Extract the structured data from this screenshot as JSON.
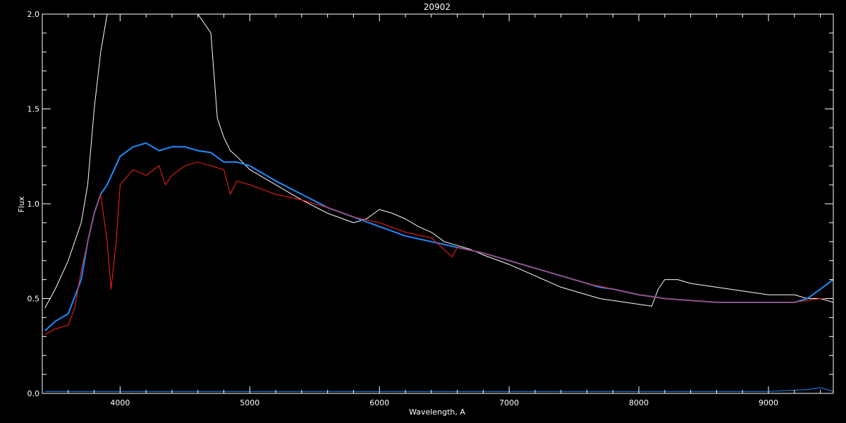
{
  "chart_data": {
    "type": "line",
    "title": "20902",
    "xlabel": "Wavelength, A",
    "ylabel": "Flux",
    "xlim": [
      3400,
      9500
    ],
    "ylim": [
      0.0,
      2.0
    ],
    "x_ticks": [
      4000,
      5000,
      6000,
      7000,
      8000,
      9000
    ],
    "x_tick_labels": [
      "4000",
      "5000",
      "6000",
      "7000",
      "8000",
      "9000"
    ],
    "y_ticks": [
      0.0,
      0.5,
      1.0,
      1.5,
      2.0
    ],
    "y_tick_labels": [
      "0.0",
      "0.5",
      "1.0",
      "1.5",
      "2.0"
    ],
    "background": "#000000",
    "axes_color": "#ffffff",
    "grid": false,
    "legend": "none",
    "series": [
      {
        "color": "#ffffff",
        "x": [
          3420,
          3500,
          3600,
          3700,
          3750,
          3800,
          3850,
          3900,
          4000,
          4100,
          4200,
          4300,
          4400,
          4500,
          4600,
          4700,
          4750,
          4800,
          4850,
          4900,
          5000,
          5200,
          5400,
          5600,
          5800,
          5900,
          6000,
          6100,
          6200,
          6300,
          6400,
          6500,
          6600,
          6700,
          6800,
          7000,
          7200,
          7400,
          7600,
          7700,
          7800,
          7900,
          8000,
          8100,
          8150,
          8200,
          8300,
          8400,
          8600,
          8800,
          9000,
          9200,
          9300,
          9400,
          9500
        ],
        "y": [
          0.45,
          0.55,
          0.7,
          0.9,
          1.1,
          1.5,
          1.8,
          2.0,
          2.0,
          2.0,
          2.0,
          2.0,
          2.0,
          2.0,
          2.0,
          1.9,
          1.45,
          1.35,
          1.28,
          1.25,
          1.18,
          1.1,
          1.02,
          0.95,
          0.9,
          0.92,
          0.97,
          0.95,
          0.92,
          0.88,
          0.85,
          0.8,
          0.78,
          0.76,
          0.73,
          0.68,
          0.62,
          0.56,
          0.52,
          0.5,
          0.49,
          0.48,
          0.47,
          0.46,
          0.55,
          0.6,
          0.6,
          0.58,
          0.56,
          0.54,
          0.52,
          0.52,
          0.5,
          0.5,
          0.48
        ]
      },
      {
        "color": "#1e8cff",
        "x": [
          3420,
          3500,
          3600,
          3700,
          3750,
          3800,
          3850,
          3900,
          4000,
          4100,
          4200,
          4300,
          4400,
          4500,
          4600,
          4700,
          4800,
          4900,
          5000,
          5200,
          5400,
          5600,
          5800,
          6000,
          6200,
          6400,
          6600,
          6800,
          7000,
          7200,
          7400,
          7600,
          7700,
          7800,
          8000,
          8100,
          8200,
          8400,
          8600,
          8800,
          9000,
          9200,
          9300,
          9400,
          9500
        ],
        "y": [
          0.33,
          0.38,
          0.42,
          0.6,
          0.8,
          0.95,
          1.05,
          1.1,
          1.25,
          1.3,
          1.32,
          1.28,
          1.3,
          1.3,
          1.28,
          1.27,
          1.22,
          1.22,
          1.2,
          1.12,
          1.05,
          0.98,
          0.93,
          0.88,
          0.83,
          0.8,
          0.77,
          0.74,
          0.7,
          0.66,
          0.62,
          0.58,
          0.56,
          0.55,
          0.52,
          0.51,
          0.5,
          0.49,
          0.48,
          0.48,
          0.48,
          0.48,
          0.5,
          0.55,
          0.6
        ]
      },
      {
        "color": "#ff2020",
        "x": [
          3420,
          3500,
          3600,
          3650,
          3700,
          3750,
          3800,
          3850,
          3900,
          3930,
          3970,
          4000,
          4100,
          4200,
          4300,
          4350,
          4400,
          4500,
          4600,
          4700,
          4800,
          4850,
          4900,
          5000,
          5200,
          5400,
          5600,
          5800,
          6000,
          6200,
          6400,
          6560,
          6600,
          6800,
          7000,
          7200,
          7400,
          7600,
          7800,
          8000,
          8200,
          8400,
          8600,
          8800,
          9000,
          9200,
          9400,
          9500
        ],
        "y": [
          0.31,
          0.34,
          0.36,
          0.45,
          0.65,
          0.8,
          0.95,
          1.05,
          0.8,
          0.55,
          0.8,
          1.1,
          1.18,
          1.15,
          1.2,
          1.1,
          1.15,
          1.2,
          1.22,
          1.2,
          1.18,
          1.05,
          1.12,
          1.1,
          1.05,
          1.02,
          0.98,
          0.93,
          0.9,
          0.85,
          0.82,
          0.72,
          0.77,
          0.74,
          0.7,
          0.66,
          0.62,
          0.58,
          0.55,
          0.52,
          0.5,
          0.49,
          0.48,
          0.48,
          0.48,
          0.48,
          0.5,
          0.5
        ]
      },
      {
        "color": "#1e8cff",
        "x": [
          3420,
          4000,
          5000,
          6000,
          7000,
          8000,
          9000,
          9300,
          9400,
          9500
        ],
        "y": [
          0.01,
          0.01,
          0.01,
          0.01,
          0.01,
          0.01,
          0.01,
          0.02,
          0.03,
          0.01
        ]
      }
    ]
  }
}
